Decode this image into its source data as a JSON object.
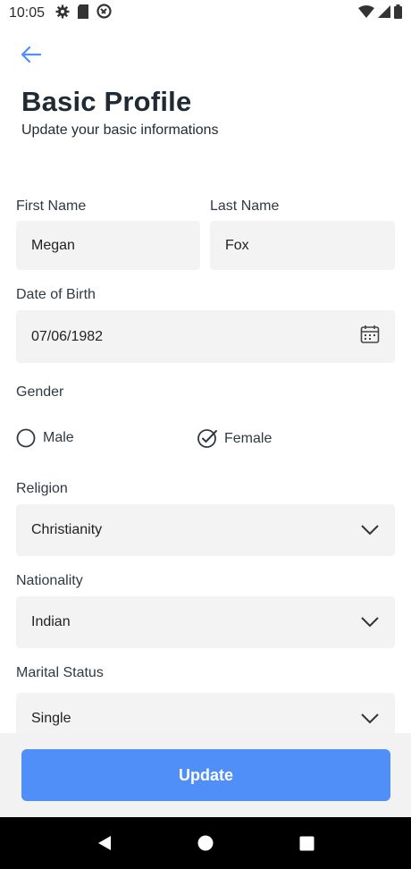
{
  "status_bar": {
    "time": "10:05",
    "icons_left": [
      "settings-icon",
      "sd-card-icon",
      "sync-icon"
    ],
    "icons_right": [
      "wifi-icon",
      "signal-icon",
      "battery-icon"
    ]
  },
  "header": {
    "back_icon": "arrow-left-icon",
    "title": "Basic Profile",
    "subtitle": "Update your basic informations"
  },
  "form": {
    "first_name": {
      "label": "First Name",
      "value": "Megan"
    },
    "last_name": {
      "label": "Last Name",
      "value": "Fox"
    },
    "dob": {
      "label": "Date of Birth",
      "value": "07/06/1982",
      "icon": "calendar-icon"
    },
    "gender": {
      "label": "Gender",
      "options": [
        {
          "label": "Male",
          "selected": false
        },
        {
          "label": "Female",
          "selected": true
        }
      ]
    },
    "religion": {
      "label": "Religion",
      "value": "Christianity"
    },
    "nationality": {
      "label": "Nationality",
      "value": "Indian"
    },
    "marital_status": {
      "label": "Marital Status",
      "value": "Single"
    }
  },
  "actions": {
    "update_label": "Update"
  },
  "colors": {
    "accent": "#4f8ff7",
    "field_bg": "#f3f3f3",
    "title": "#1f2a33"
  },
  "nav": {
    "icons": [
      "back-triangle-icon",
      "home-circle-icon",
      "recents-square-icon"
    ]
  }
}
